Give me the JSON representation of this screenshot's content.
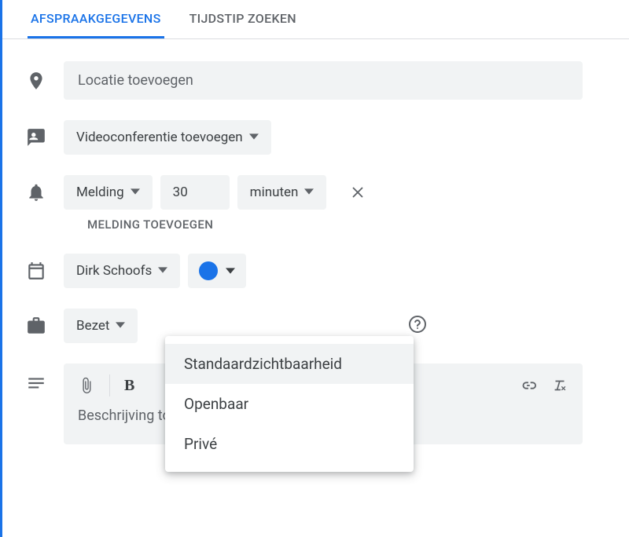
{
  "tabs": {
    "details": "AFSPRAAKGEGEVENS",
    "findtime": "TIJDSTIP ZOEKEN"
  },
  "location": {
    "placeholder": "Locatie toevoegen"
  },
  "videoconf": {
    "label": "Videoconferentie toevoegen"
  },
  "notification": {
    "type": "Melding",
    "value": "30",
    "unit": "minuten"
  },
  "addNotification": "MELDING TOEVOEGEN",
  "calendar": {
    "owner": "Dirk Schoofs"
  },
  "availability": {
    "label": "Bezet"
  },
  "visibilityMenu": {
    "default": "Standaardzichtbaarheid",
    "public": "Openbaar",
    "private": "Privé"
  },
  "description": {
    "placeholder": "Beschrijving toevoegen"
  }
}
